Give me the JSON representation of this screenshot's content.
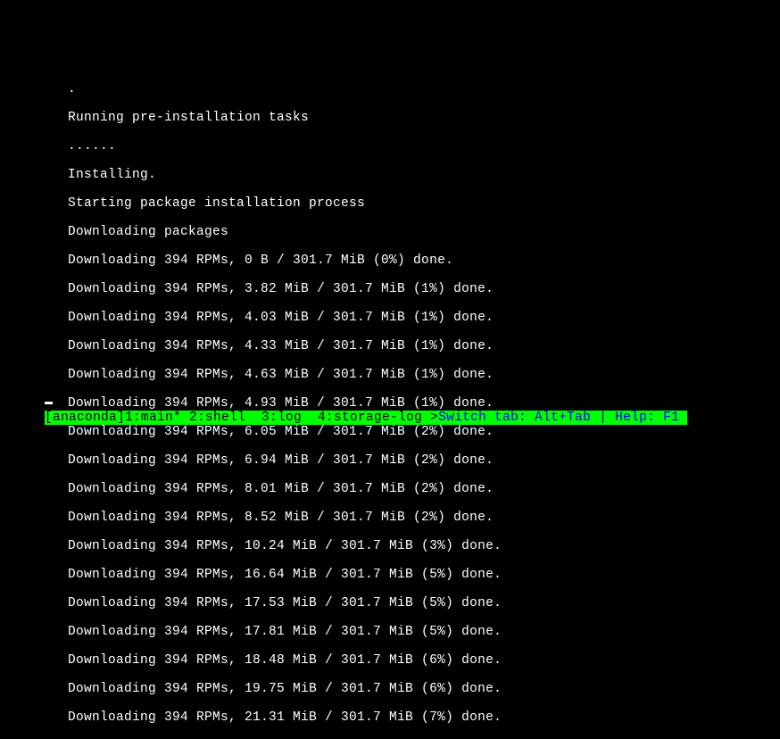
{
  "terminal": {
    "lines": [
      ".",
      "Running pre-installation tasks",
      "......",
      "Installing.",
      "Starting package installation process",
      "Downloading packages",
      "Downloading 394 RPMs, 0 B / 301.7 MiB (0%) done.",
      "Downloading 394 RPMs, 3.82 MiB / 301.7 MiB (1%) done.",
      "Downloading 394 RPMs, 4.03 MiB / 301.7 MiB (1%) done.",
      "Downloading 394 RPMs, 4.33 MiB / 301.7 MiB (1%) done.",
      "Downloading 394 RPMs, 4.63 MiB / 301.7 MiB (1%) done.",
      "Downloading 394 RPMs, 4.93 MiB / 301.7 MiB (1%) done.",
      "Downloading 394 RPMs, 6.05 MiB / 301.7 MiB (2%) done.",
      "Downloading 394 RPMs, 6.94 MiB / 301.7 MiB (2%) done.",
      "Downloading 394 RPMs, 8.01 MiB / 301.7 MiB (2%) done.",
      "Downloading 394 RPMs, 8.52 MiB / 301.7 MiB (2%) done.",
      "Downloading 394 RPMs, 10.24 MiB / 301.7 MiB (3%) done.",
      "Downloading 394 RPMs, 16.64 MiB / 301.7 MiB (5%) done.",
      "Downloading 394 RPMs, 17.53 MiB / 301.7 MiB (5%) done.",
      "Downloading 394 RPMs, 17.81 MiB / 301.7 MiB (5%) done.",
      "Downloading 394 RPMs, 18.48 MiB / 301.7 MiB (6%) done.",
      "Downloading 394 RPMs, 19.75 MiB / 301.7 MiB (6%) done.",
      "Downloading 394 RPMs, 21.31 MiB / 301.7 MiB (7%) done."
    ]
  },
  "statusbar": {
    "tabs": "[anaconda]1:main* 2:shell  3:log  4:storage-log >",
    "help": "Switch tab: Alt+Tab | Help: F1 "
  }
}
